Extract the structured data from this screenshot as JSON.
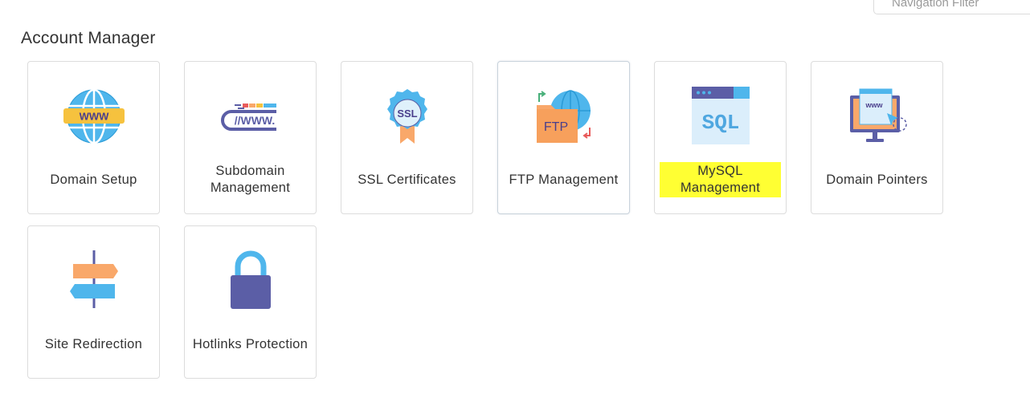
{
  "nav_filter": {
    "placeholder": "Navigation Filter"
  },
  "section": {
    "title": "Account Manager"
  },
  "tiles": [
    {
      "label": "Domain Setup",
      "icon": "globe-www-icon"
    },
    {
      "label": "Subdomain Management",
      "icon": "www-address-bar-icon"
    },
    {
      "label": "SSL Certificates",
      "icon": "ssl-badge-icon"
    },
    {
      "label": "FTP Management",
      "icon": "ftp-folder-globe-icon"
    },
    {
      "label": "MySQL Management",
      "icon": "sql-window-icon",
      "highlighted": true
    },
    {
      "label": "Domain Pointers",
      "icon": "monitor-pointer-icon"
    },
    {
      "label": "Site Redirection",
      "icon": "signpost-icon"
    },
    {
      "label": "Hotlinks Protection",
      "icon": "padlock-icon"
    }
  ],
  "icon_text": {
    "www": "WWW",
    "subdomain_www": "//WWW.",
    "ssl": "SSL",
    "ftp": "FTP",
    "sql": "SQL",
    "monitor_www": "www"
  },
  "colors": {
    "highlight": "#ffff33",
    "tile_border": "#dcdcdc",
    "globe_blue": "#4fb6ec",
    "orange": "#f9a86a",
    "purple": "#5b5ea6"
  }
}
